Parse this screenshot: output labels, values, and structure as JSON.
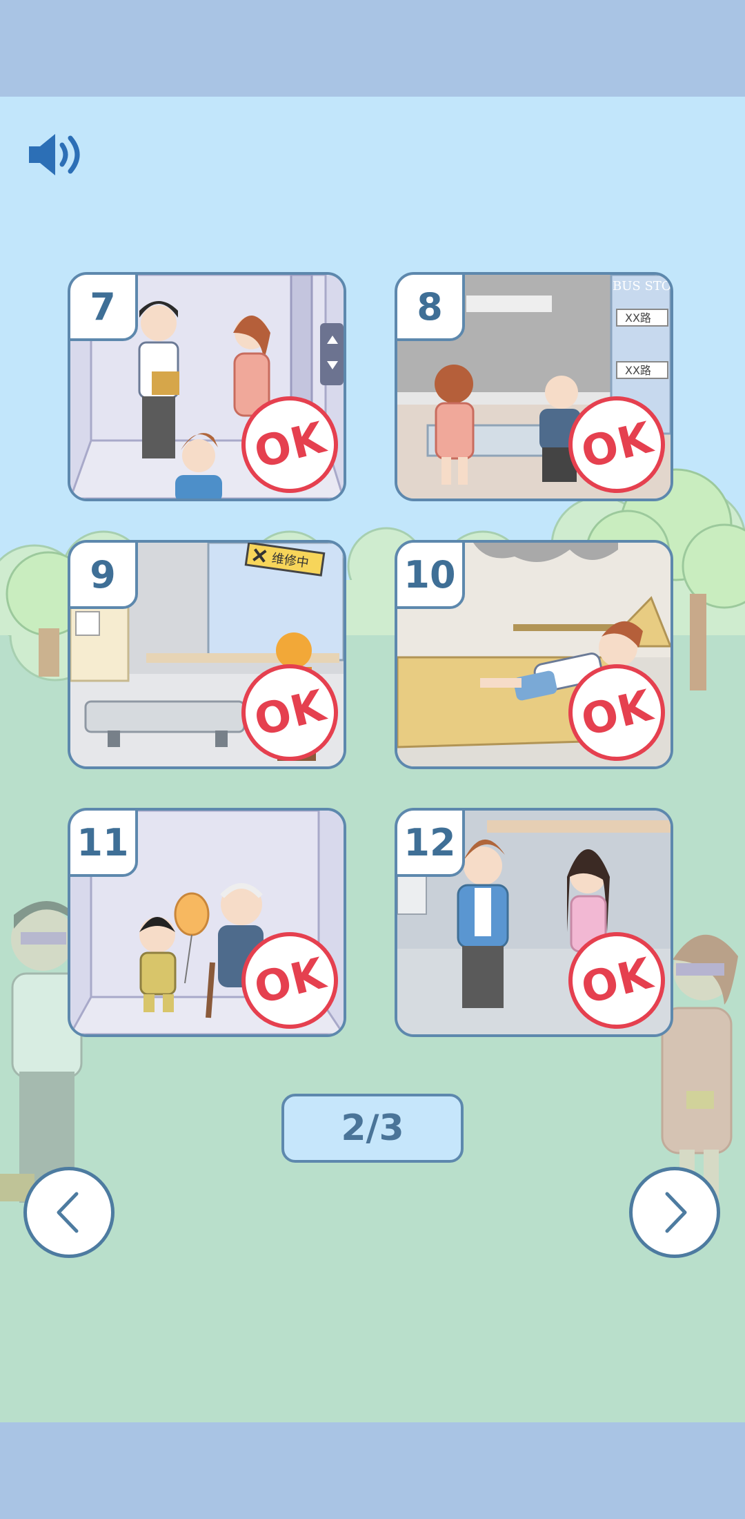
{
  "level_select": {
    "page_indicator": "2/3",
    "levels": [
      {
        "number": "7",
        "status": "OK",
        "scene": "elevator"
      },
      {
        "number": "8",
        "status": "OK",
        "scene": "bus-stop"
      },
      {
        "number": "9",
        "status": "OK",
        "scene": "platform-under-repair"
      },
      {
        "number": "10",
        "status": "OK",
        "scene": "person-lying-on-bench"
      },
      {
        "number": "11",
        "status": "OK",
        "scene": "elevator-child-and-elder"
      },
      {
        "number": "12",
        "status": "OK",
        "scene": "young-man-and-woman"
      }
    ],
    "scene_signs": {
      "bus_stop": "BUS STO",
      "road_1": "XX路",
      "road_2": "XX路",
      "repair": "维修中"
    }
  },
  "controls": {
    "sound_icon": "speaker-icon",
    "prev_icon": "chevron-left-icon",
    "next_icon": "chevron-right-icon"
  },
  "colors": {
    "background_sky": "#c2e6fb",
    "ground": "#b9dfcb",
    "frame_border": "#5d88ad",
    "ok_red": "#e5404f",
    "number_blue": "#3f6f96"
  }
}
